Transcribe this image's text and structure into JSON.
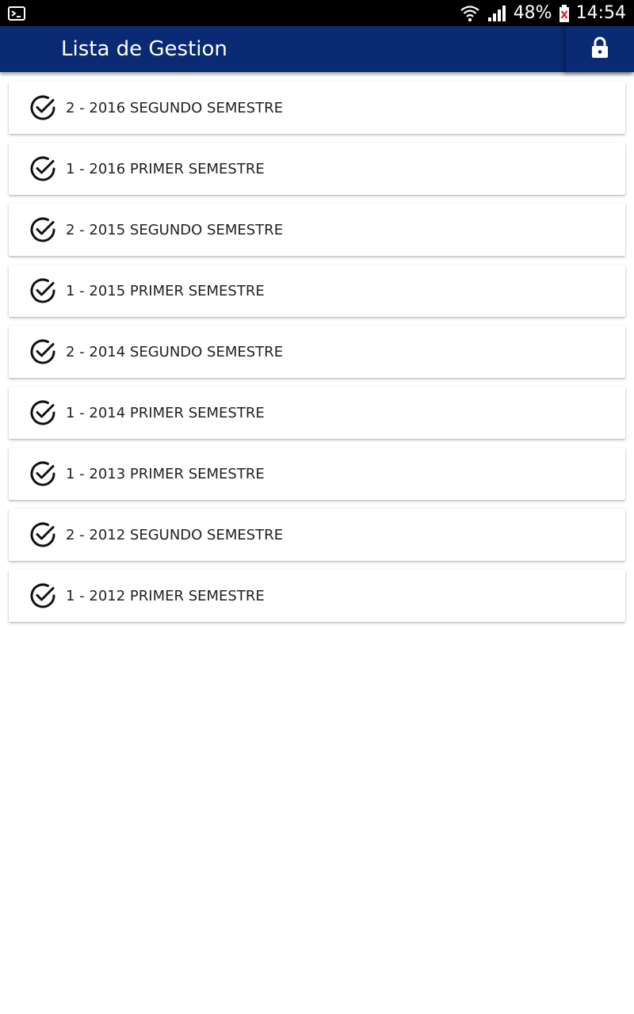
{
  "status_bar": {
    "battery_text": "48%",
    "time": "14:54",
    "icons": [
      "terminal-notification-icon",
      "wifi-icon",
      "signal-icon",
      "battery-icon"
    ]
  },
  "app_bar": {
    "title": "Lista de Gestion",
    "background_color": "#0a2b73",
    "action_icon": "lock-icon"
  },
  "list": {
    "item_icon": "check-circle-icon",
    "items": [
      {
        "label": "2 - 2016 SEGUNDO SEMESTRE"
      },
      {
        "label": "1 - 2016 PRIMER SEMESTRE"
      },
      {
        "label": "2 - 2015 SEGUNDO SEMESTRE"
      },
      {
        "label": "1 - 2015 PRIMER SEMESTRE"
      },
      {
        "label": "2 - 2014 SEGUNDO SEMESTRE"
      },
      {
        "label": "1 - 2014 PRIMER SEMESTRE"
      },
      {
        "label": "1 - 2013 PRIMER SEMESTRE"
      },
      {
        "label": "2 - 2012 SEGUNDO SEMESTRE"
      },
      {
        "label": "1 - 2012 PRIMER SEMESTRE"
      }
    ]
  }
}
